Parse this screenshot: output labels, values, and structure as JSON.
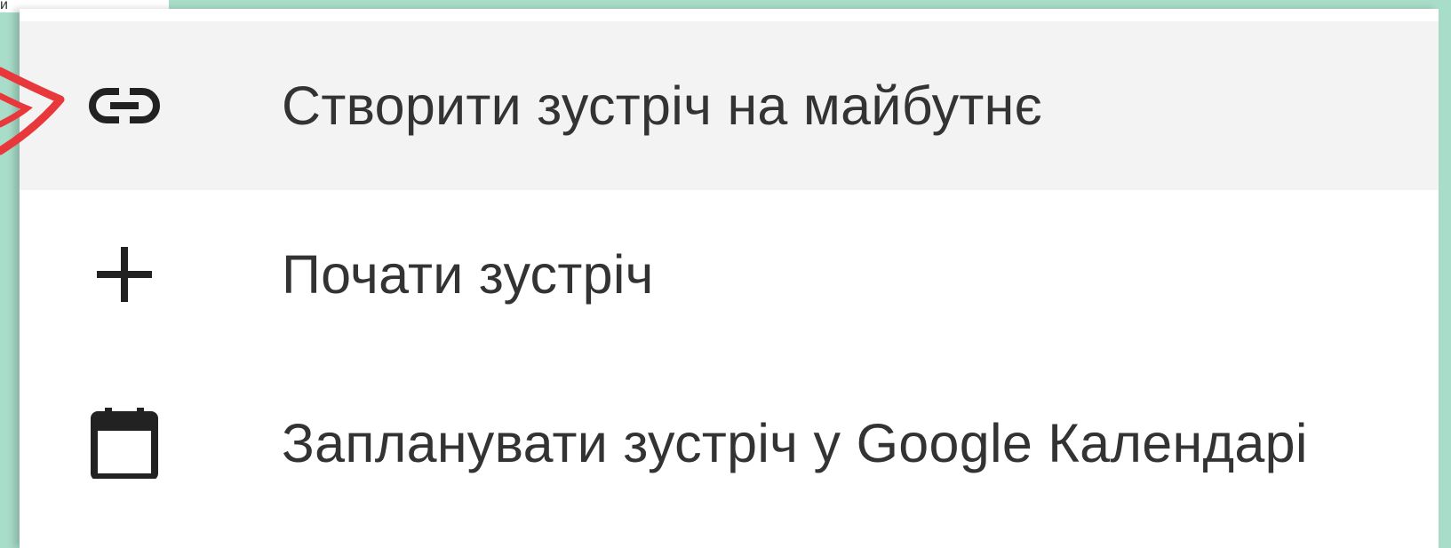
{
  "corner_text": "и",
  "menu": {
    "items": [
      {
        "label": "Створити зустріч на майбутнє",
        "icon": "link-icon",
        "highlighted": true
      },
      {
        "label": "Почати зустріч",
        "icon": "plus-icon",
        "highlighted": false
      },
      {
        "label": "Запланувати зустріч у Google Календарі",
        "icon": "calendar-icon",
        "highlighted": false
      }
    ]
  },
  "colors": {
    "frame": "#a8ddc9",
    "highlight": "#f3f3f3",
    "text": "#333333",
    "annotation_arrow": "#e8383c"
  }
}
